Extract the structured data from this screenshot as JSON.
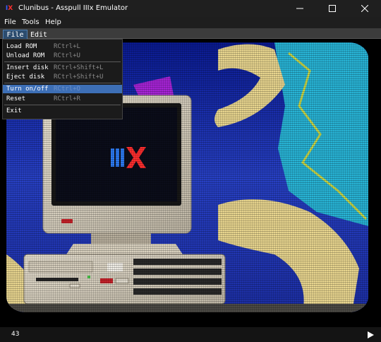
{
  "window": {
    "title": "Clunibus - Asspull IIIx Emulator",
    "icon_text_a": "I",
    "icon_text_b": "X"
  },
  "menubar": {
    "items": [
      "File",
      "Tools",
      "Help"
    ]
  },
  "emulated_menubar": {
    "file_label": "File",
    "edit_label": "Edit"
  },
  "file_menu": {
    "items": [
      {
        "label": "Load ROM",
        "shortcut": "RCtrl+L"
      },
      {
        "label": "Unload ROM",
        "shortcut": "RCtrl+U"
      },
      {
        "label": "Insert disk",
        "shortcut": "RCtrl+Shift+L"
      },
      {
        "label": "Eject disk",
        "shortcut": "RCtrl+Shift+U"
      },
      {
        "label": "Turn on/off",
        "shortcut": "RCtrl+O"
      },
      {
        "label": "Reset",
        "shortcut": "RCtrl+R"
      },
      {
        "label": "Exit",
        "shortcut": ""
      }
    ],
    "highlighted_index": 4
  },
  "statusbar": {
    "count": "43"
  },
  "colors": {
    "highlight": "#3d6fb6",
    "screen_blue": "#1a2ea8",
    "skin": "#e8d58f",
    "cyan_suit": "#28b4d6"
  },
  "icons": {
    "minimize": "minimize-icon",
    "maximize": "maximize-icon",
    "close": "close-icon",
    "play": "play-icon"
  }
}
